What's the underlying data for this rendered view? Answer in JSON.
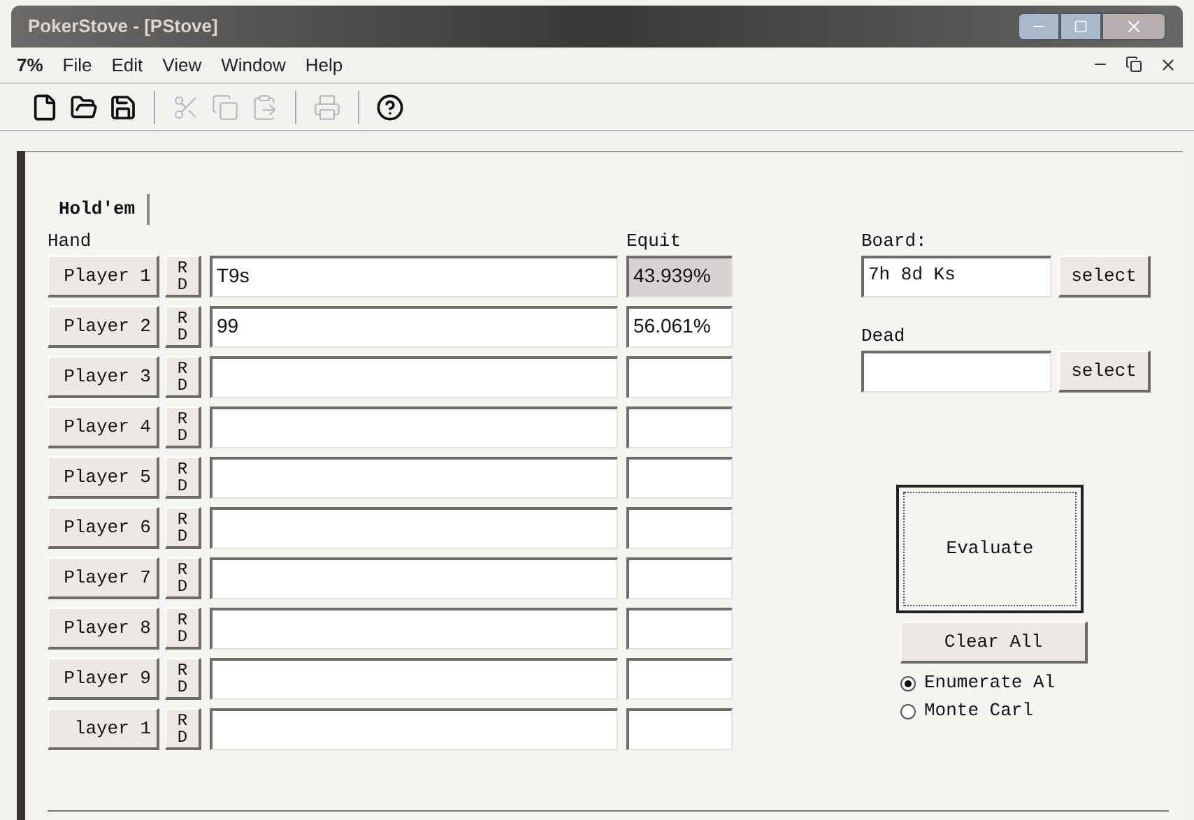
{
  "window": {
    "title": "PokerStove - [PStove]"
  },
  "menu": {
    "app_label": "7%",
    "items": [
      "File",
      "Edit",
      "View",
      "Window",
      "Help"
    ]
  },
  "toolbar": [
    {
      "kind": "new",
      "disabled": false
    },
    {
      "kind": "open",
      "disabled": false
    },
    {
      "kind": "save",
      "disabled": false
    },
    {
      "kind": "cut",
      "disabled": true
    },
    {
      "kind": "copy",
      "disabled": true
    },
    {
      "kind": "paste",
      "disabled": true
    },
    {
      "kind": "print",
      "disabled": true
    },
    {
      "kind": "help",
      "disabled": false
    }
  ],
  "tabs": [
    {
      "label": "Hold'em",
      "selected": true
    }
  ],
  "hand_header": "Hand",
  "equity_header": "Equit",
  "players": [
    {
      "label": "Player 1",
      "rd_top": "R",
      "rd_bottom": "D",
      "hand": "T9s",
      "equity": "43.939%",
      "highlighted": true
    },
    {
      "label": "Player 2",
      "rd_top": "R",
      "rd_bottom": "D",
      "hand": "99",
      "equity": "56.061%",
      "highlighted": false
    },
    {
      "label": "Player 3",
      "rd_top": "R",
      "rd_bottom": "D",
      "highlighted": false
    },
    {
      "label": "Player 4",
      "rd_top": "R",
      "rd_bottom": "D",
      "highlighted": false
    },
    {
      "label": "Player 5",
      "rd_top": "R",
      "rd_bottom": "D",
      "highlighted": false
    },
    {
      "label": "Player 6",
      "rd_top": "R",
      "rd_bottom": "D",
      "highlighted": false
    },
    {
      "label": "Player 7",
      "rd_top": "R",
      "rd_bottom": "D",
      "highlighted": false
    },
    {
      "label": "Player 8",
      "rd_top": "R",
      "rd_bottom": "D",
      "highlighted": false
    },
    {
      "label": "Player 9",
      "rd_top": "R",
      "rd_bottom": "D",
      "highlighted": false
    },
    {
      "label": "layer 1",
      "rd_top": "R",
      "rd_bottom": "D",
      "highlighted": false
    }
  ],
  "board": {
    "label": "Board:",
    "value": "7h 8d Ks",
    "button": "select"
  },
  "dead": {
    "label": "Dead",
    "button": "select"
  },
  "evaluate": "Evaluate",
  "clear_all": "Clear All",
  "modes": [
    {
      "label": "Enumerate Al",
      "selected": true
    },
    {
      "label": "Monte Carl",
      "selected": false
    }
  ]
}
